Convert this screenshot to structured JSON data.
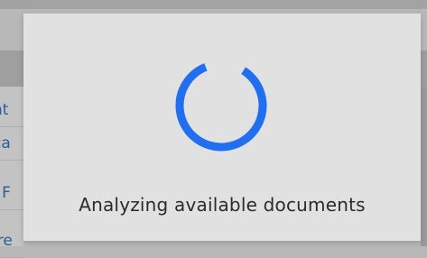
{
  "background": {
    "left_items": [
      "nt",
      "ca",
      "l F",
      "ire"
    ]
  },
  "modal": {
    "message": "Analyzing available documents",
    "spinner_icon": "loading-spinner-icon",
    "spinner_color": "#1f6ff0"
  }
}
